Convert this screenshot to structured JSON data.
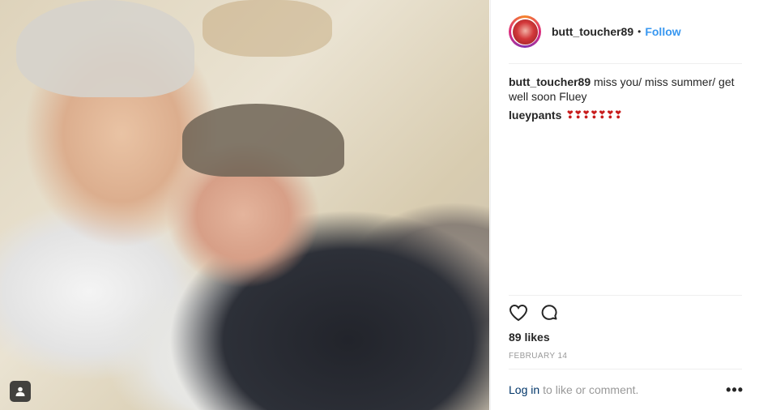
{
  "post": {
    "username": "butt_toucher89",
    "separator": "•",
    "follow_label": "Follow",
    "caption_user": "butt_toucher89",
    "caption_text": "miss you/ miss summer/ get well soon Fluey",
    "comment_user": "lueypants",
    "comment_text": "❣❣❣❣❣❣❣",
    "likes": "89 likes",
    "date": "FEBRUARY 14",
    "login_link": "Log in",
    "login_rest": "to like or comment.",
    "more_label": "•••"
  },
  "icons": {
    "like": "heart-outline-icon",
    "comment": "comment-bubble-icon",
    "tagged": "user-tag-icon"
  },
  "colors": {
    "follow": "#3897f0",
    "link": "#003569",
    "muted": "#999999",
    "hearts": "#c81c1c"
  }
}
